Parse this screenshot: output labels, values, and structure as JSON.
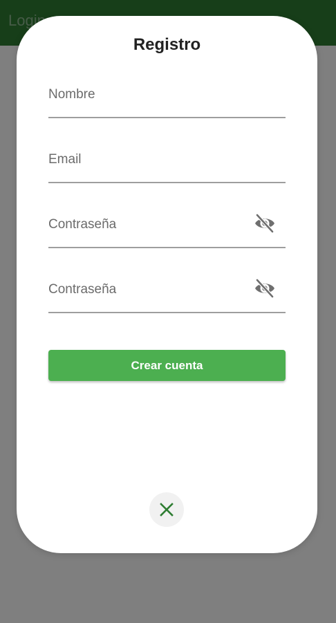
{
  "app_bar": {
    "title": "Login"
  },
  "dialog": {
    "title": "Registro",
    "fields": {
      "name": {
        "placeholder": "Nombre",
        "value": ""
      },
      "email": {
        "placeholder": "Email",
        "value": ""
      },
      "password": {
        "placeholder": "Contraseña",
        "value": "",
        "visibility_icon": "visibility-off-icon"
      },
      "password_confirm": {
        "placeholder": "Contraseña",
        "value": "",
        "visibility_icon": "visibility-off-icon"
      }
    },
    "submit_label": "Crear cuenta",
    "close_icon": "close-icon"
  },
  "colors": {
    "app_bar": "#2e7d32",
    "primary_button": "#4caf50",
    "close_icon": "#2e7d32",
    "scrim": "#808080",
    "underline": "#9e9e9e"
  }
}
